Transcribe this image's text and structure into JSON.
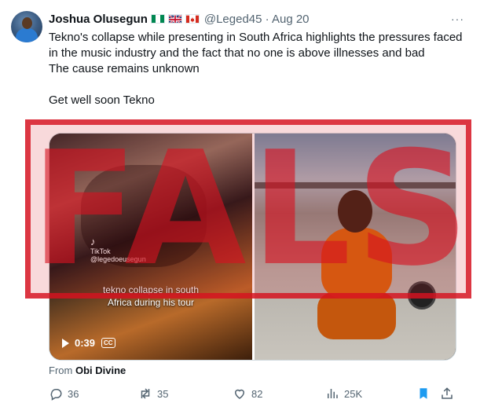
{
  "tweet": {
    "author_name": "Joshua Olusegun",
    "handle_and_date": "@Leged45 · Aug 20",
    "more_label": "···",
    "text_line1": "Tekno's collapse while presenting in South Africa highlights the pressures faced in the music industry and the fact that no one is above illnesses and bad",
    "text_line2": "The cause remains unknown",
    "text_line3": "Get well soon Tekno",
    "from_prefix": "From",
    "from_name": "Obi Divine"
  },
  "media": {
    "left_caption_line1": "tekno collapse in south",
    "left_caption_line2": "Africa during his tour",
    "watermark_brand": "TikTok",
    "watermark_user": "@legedoeusegun",
    "video_time": "0:39",
    "cc_label": "CC"
  },
  "stamp": {
    "word": "FALSE",
    "color": "#d61220"
  },
  "actions": {
    "replies": "36",
    "reposts": "35",
    "likes": "82",
    "views": "25K"
  },
  "colors": {
    "text": "#0f1419",
    "muted": "#536471",
    "accent": "#1d9bf0"
  },
  "icons": [
    "more-icon",
    "play-icon",
    "cc-icon",
    "reply-icon",
    "repost-icon",
    "like-icon",
    "views-icon",
    "bookmark-icon",
    "share-icon"
  ]
}
